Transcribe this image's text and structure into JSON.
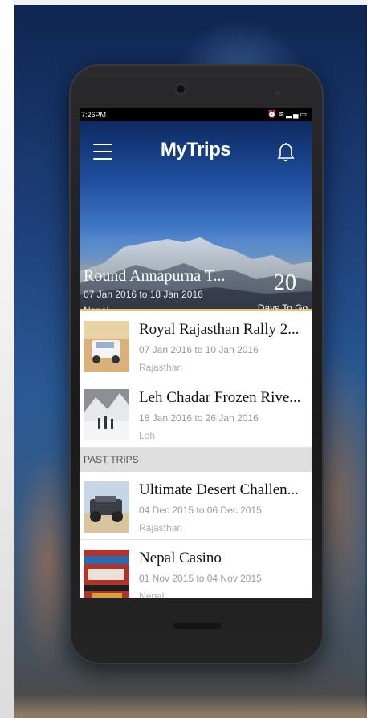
{
  "status_bar": {
    "time": "7:26PM"
  },
  "header": {
    "title": "MyTrips",
    "menu_icon": "hamburger-menu-icon",
    "notification_icon": "bell-icon"
  },
  "featured_trip": {
    "title": "Round Annapurna T...",
    "dates": "07 Jan 2016 to 18 Jan 2016",
    "location": "Nepal",
    "days_count": "20",
    "days_label": "Days To Go"
  },
  "upcoming_trips": [
    {
      "title": "Royal Rajasthan Rally 2...",
      "dates": "07 Jan 2016 to 10 Jan 2016",
      "location": "Rajasthan"
    },
    {
      "title": "Leh Chadar Frozen Rive...",
      "dates": "18 Jan 2016 to 26 Jan 2016",
      "location": "Leh"
    }
  ],
  "past_section": {
    "label": "PAST TRIPS"
  },
  "past_trips": [
    {
      "title": "Ultimate Desert Challen...",
      "dates": "04 Dec 2015 to 06 Dec 2015",
      "location": "Rajasthan"
    },
    {
      "title": "Nepal Casino",
      "dates": "01 Nov 2015 to 04 Nov 2015",
      "location": "Nepal"
    }
  ],
  "colors": {
    "accent_bar": "#e7c27a",
    "section_bg": "#dedede",
    "hero_sky": "#1e4c9a"
  }
}
